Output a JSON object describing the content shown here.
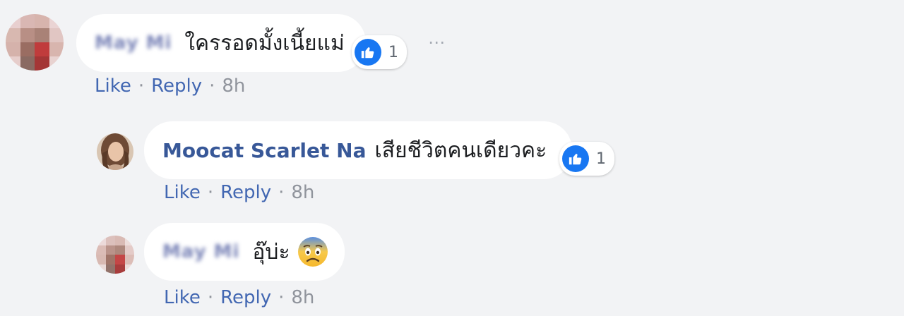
{
  "comments": [
    {
      "author": "May Mi",
      "text": "ใครรอดมั้งเนี้ยแม่",
      "reaction_count": "1",
      "actions": {
        "like": "Like",
        "reply": "Reply",
        "time": "8h",
        "dot": "·"
      }
    },
    {
      "author": "Moocat Scarlet Na",
      "text": "เสียชีวิตคนเดียวคะ",
      "reaction_count": "1",
      "actions": {
        "like": "Like",
        "reply": "Reply",
        "time": "8h",
        "dot": "·"
      }
    },
    {
      "author": "May Mi",
      "text": "อุ๊บ่ะ",
      "emoji": "fearful-face-emoji",
      "actions": {
        "like": "Like",
        "reply": "Reply",
        "time": "8h",
        "dot": "·"
      }
    }
  ],
  "more_icon": "⋯",
  "colors": {
    "background": "#f2f3f5",
    "bubble": "#ffffff",
    "author": "#385898",
    "link": "#4267b2",
    "meta": "#90949c",
    "like": "#1877f2"
  }
}
